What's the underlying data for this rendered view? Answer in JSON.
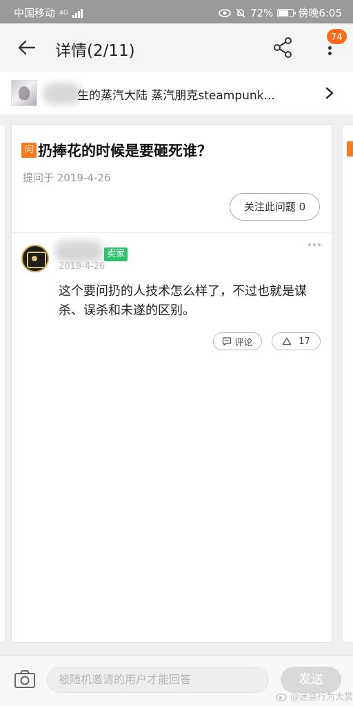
{
  "status_bar": {
    "carrier": "中国移动",
    "net_type": "4G",
    "battery_percent": 72,
    "battery_text": "72%",
    "time": "傍晚6:05"
  },
  "header": {
    "title": "详情(2/11)",
    "notification_count": "74"
  },
  "group": {
    "name": "生的蒸汽大陆 蒸汽朋克steampunk..."
  },
  "question": {
    "tag": "问",
    "title": "扔捧花的时候是要砸死谁？",
    "asked_date": "提问于 2019-4-26",
    "follow_button": "关注此问题 0"
  },
  "answer": {
    "seller_badge": "卖家",
    "date": "2019-4-26",
    "text": "这个要问扔的人技术怎么样了，不过也就是谋杀、误杀和未遂的区别。",
    "comment_label": "评论",
    "like_count": "17"
  },
  "composer": {
    "placeholder": "被随机邀请的用户才能回答",
    "send_label": "发送"
  },
  "watermark": {
    "text": "@迷惑行为大赏"
  },
  "colors": {
    "accent_orange": "#ff7a1f",
    "badge_orange": "#ff6a1a",
    "seller_green": "#2dc26b"
  }
}
